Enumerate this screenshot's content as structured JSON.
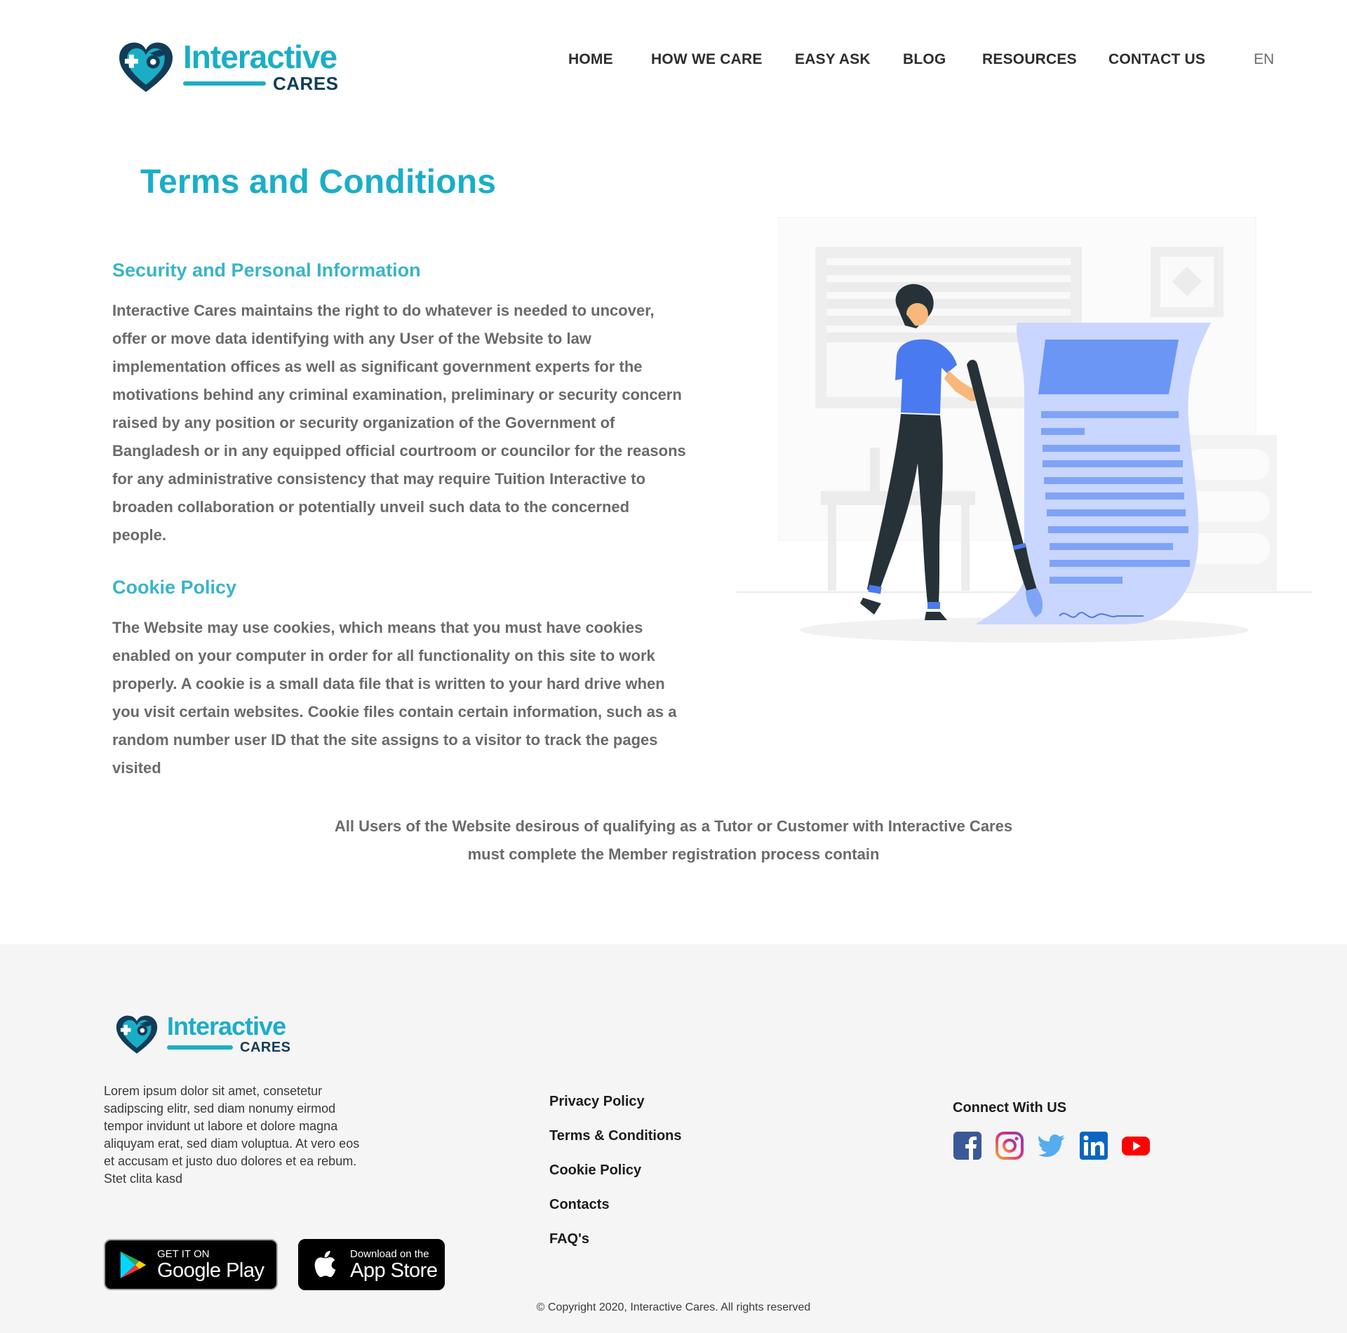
{
  "brand": {
    "name": "Interactive",
    "sub": "CARES",
    "primary_color": "#1aaec6",
    "dark_color": "#123c57"
  },
  "nav": {
    "items": [
      {
        "label": "HOME"
      },
      {
        "label": "HOW WE CARE"
      },
      {
        "label": "EASY ASK"
      },
      {
        "label": "BLOG"
      },
      {
        "label": "RESOURCES"
      },
      {
        "label": "CONTACT US"
      }
    ],
    "language": "EN"
  },
  "main": {
    "title": "Terms and Conditions",
    "sections": [
      {
        "heading": "Security and Personal Information",
        "lines": [
          "Interactive Cares maintains the right to do whatever is needed to uncover,",
          "offer or move data identifying with any User of the Website to law",
          "implementation offices as well as significant government experts for the",
          "motivations behind any criminal examination, preliminary or security concern",
          "raised by any position or security organization of the Government of",
          "Bangladesh or in any equipped official courtroom or councilor for the reasons",
          "for any administrative consistency that may require Tuition Interactive to",
          "broaden collaboration or potentially unveil such data to the concerned",
          "people."
        ]
      },
      {
        "heading": "Cookie Policy",
        "lines": [
          "The Website may use cookies, which means that you must have cookies",
          "enabled on your computer in order for all functionality on this site to work",
          "properly. A cookie is a small data file that is written to your hard drive when",
          "you visit certain websites. Cookie files contain certain information, such as a",
          "random number user ID that the site assigns to a visitor to track the pages",
          "visited"
        ]
      }
    ],
    "note_lines": [
      "All Users of the Website desirous of qualifying as a Tutor or Customer with Interactive Cares",
      "must complete the Member registration process contain"
    ],
    "illustration": "woman-signing-document-illustration"
  },
  "footer": {
    "about": "Lorem ipsum dolor sit amet, consetetur sadipscing elitr, sed diam nonumy eirmod tempor invidunt ut labore et dolore magna aliquyam erat, sed diam voluptua. At vero eos et accusam et justo duo dolores et ea rebum. Stet clita kasd",
    "google_play": {
      "small": "GET IT ON",
      "big": "Google Play"
    },
    "app_store": {
      "small": "Download on the",
      "big": "App Store"
    },
    "links": [
      {
        "label": "Privacy Policy"
      },
      {
        "label": "Terms & Conditions"
      },
      {
        "label": "Cookie Policy"
      },
      {
        "label": "Contacts"
      },
      {
        "label": "FAQ's"
      }
    ],
    "connect_title": "Connect With US",
    "social": [
      {
        "icon": "facebook-icon",
        "color": "#3b5998"
      },
      {
        "icon": "instagram-icon",
        "color": "#c13584"
      },
      {
        "icon": "twitter-icon",
        "color": "#55acee"
      },
      {
        "icon": "linkedin-icon",
        "color": "#0a66c2"
      },
      {
        "icon": "youtube-icon",
        "color": "#ff0000"
      }
    ],
    "copyright": "© Copyright 2020, Interactive Cares. All rights reserved"
  }
}
